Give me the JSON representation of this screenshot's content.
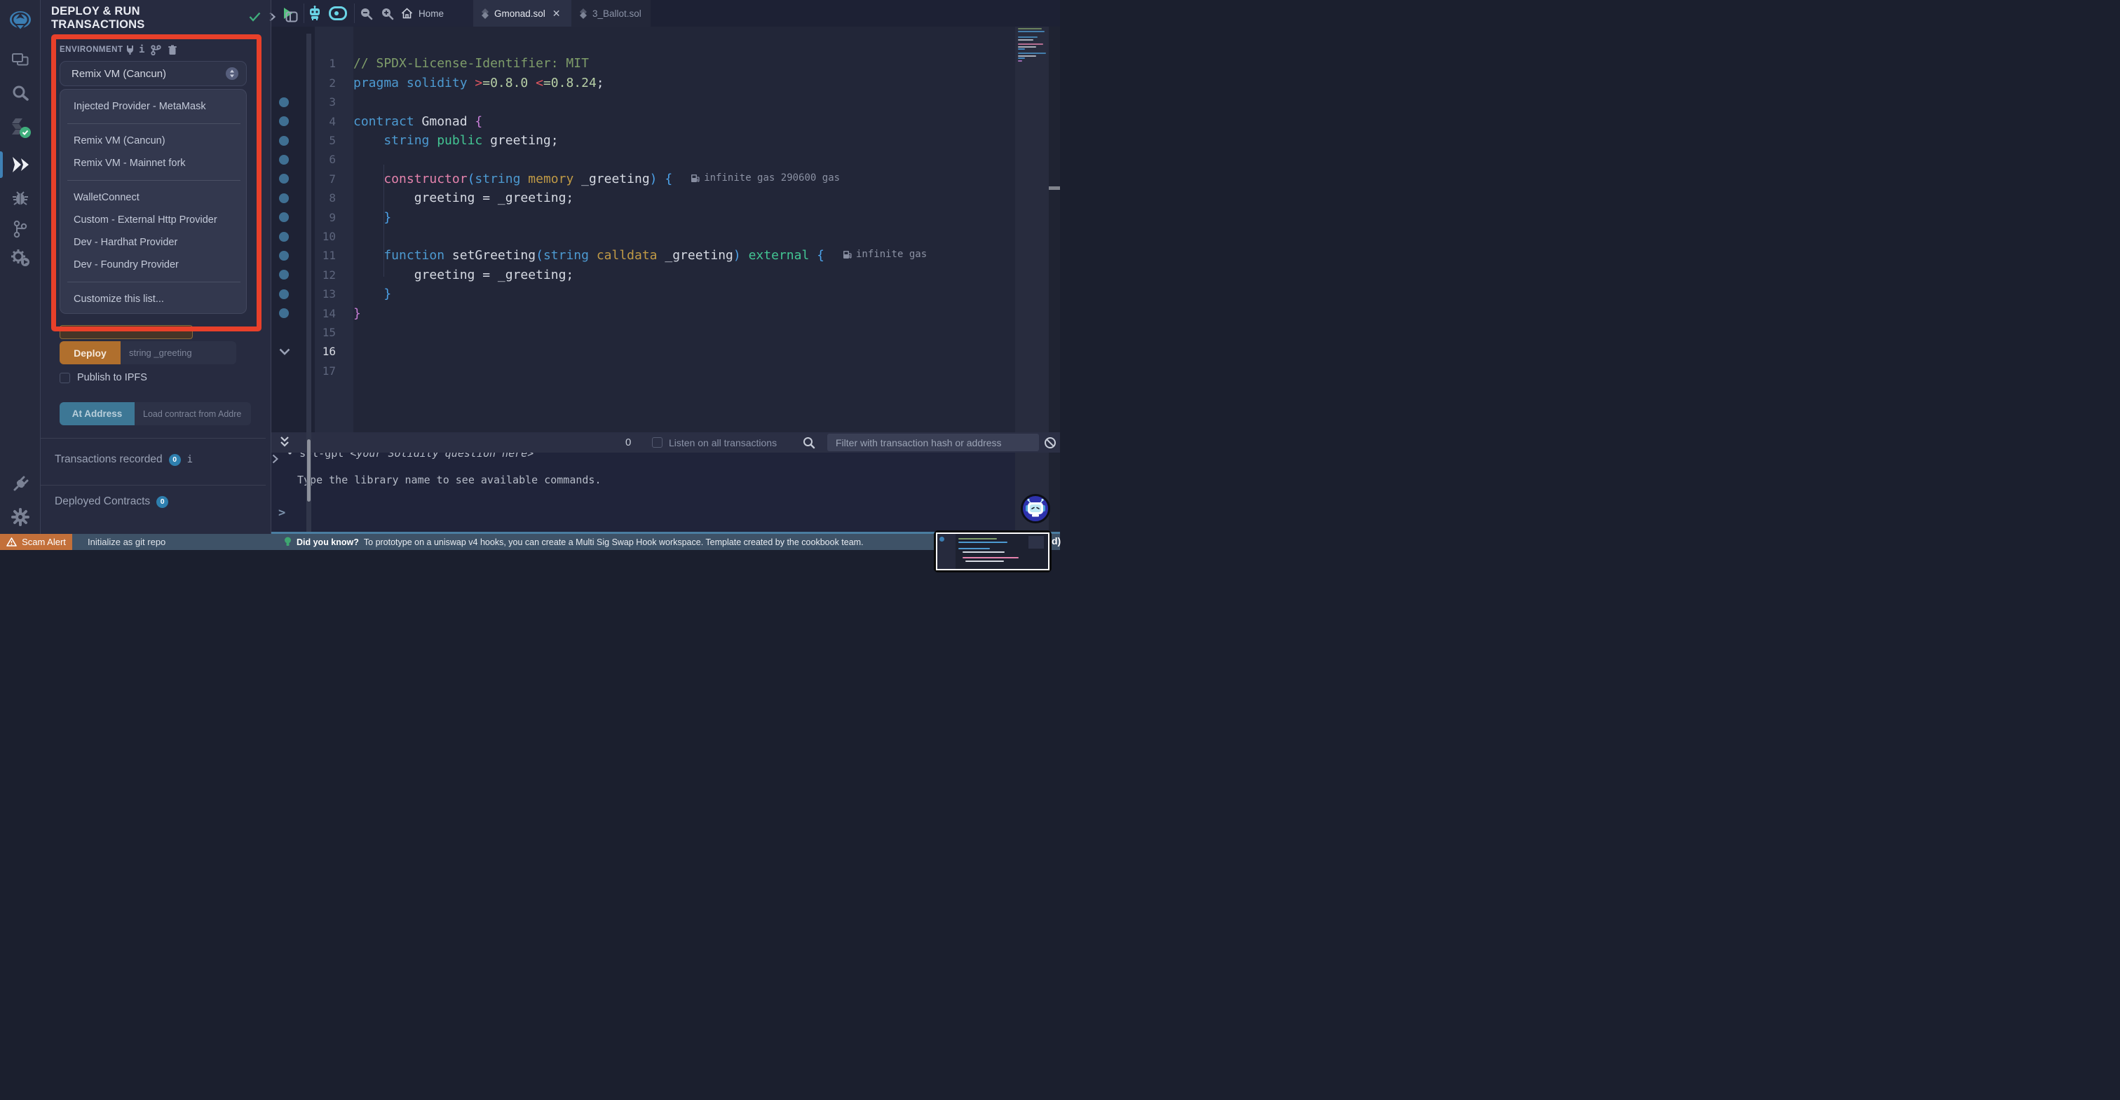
{
  "sidebar": {
    "icons": [
      {
        "name": "remix-logo"
      },
      {
        "name": "file-explorer"
      },
      {
        "name": "search"
      },
      {
        "name": "solidity-compiler"
      },
      {
        "name": "deploy-and-run"
      },
      {
        "name": "debugger"
      },
      {
        "name": "git"
      },
      {
        "name": "solidity-analyzers"
      },
      {
        "name": "plugin-manager"
      },
      {
        "name": "settings"
      }
    ]
  },
  "panel": {
    "title_line1": "DEPLOY & RUN",
    "title_line2": "TRANSACTIONS",
    "env": {
      "label": "ENVIRONMENT",
      "selected": "Remix VM (Cancun)",
      "menu": [
        [
          "Injected Provider - MetaMask"
        ],
        [
          "Remix VM (Cancun)",
          "Remix VM - Mainnet fork"
        ],
        [
          "WalletConnect",
          "Custom - External Http Provider",
          "Dev - Hardhat Provider",
          "Dev - Foundry Provider"
        ],
        [
          "Customize this list..."
        ]
      ]
    },
    "deploy": {
      "button": "Deploy",
      "placeholder": "string _greeting"
    },
    "publish_label": "Publish to IPFS",
    "at_address": {
      "button": "At Address",
      "placeholder": "Load contract from Addre"
    },
    "transactions": {
      "label": "Transactions recorded",
      "count": "0"
    },
    "deployed": {
      "label": "Deployed Contracts",
      "count": "0"
    },
    "info_glyph": "i"
  },
  "editor": {
    "home_label": "Home",
    "tabs": [
      {
        "label": "Gmonad.sol",
        "active": true
      },
      {
        "label": "3_Ballot.sol",
        "active": false
      }
    ],
    "active_line": 16,
    "total_lines": 17,
    "dotted_lines": [
      3,
      4,
      5,
      6,
      7,
      8,
      9,
      10,
      11,
      12,
      13,
      14
    ],
    "lines": [
      {
        "n": 1,
        "tokens": [
          [
            "// SPDX-License-Identifier: MIT",
            "com"
          ]
        ]
      },
      {
        "n": 2,
        "tokens": [
          [
            "pragma solidity ",
            "kw"
          ],
          [
            ">",
            "red"
          ],
          [
            "=0.8.0 ",
            "num"
          ],
          [
            "<",
            "red"
          ],
          [
            "=0.8.24",
            "num"
          ],
          [
            ";",
            "fg"
          ]
        ]
      },
      {
        "n": 3,
        "tokens": []
      },
      {
        "n": 4,
        "tokens": [
          [
            "contract ",
            "kw"
          ],
          [
            "Gmonad ",
            "fg"
          ],
          [
            "{",
            "mag"
          ]
        ]
      },
      {
        "n": 5,
        "tokens": [
          [
            "    string ",
            "kw"
          ],
          [
            "public ",
            "grn"
          ],
          [
            "greeting;",
            "fg"
          ]
        ]
      },
      {
        "n": 6,
        "tokens": []
      },
      {
        "n": 7,
        "tokens": [
          [
            "    constructor",
            "pnk"
          ],
          [
            "(",
            "blu"
          ],
          [
            "string ",
            "kw"
          ],
          [
            "memory ",
            "gld"
          ],
          [
            "_greeting",
            "fg"
          ],
          [
            ") {",
            "blu"
          ]
        ],
        "gas": "infinite gas 290600 gas"
      },
      {
        "n": 8,
        "tokens": [
          [
            "        greeting = _greeting;",
            "fg"
          ]
        ]
      },
      {
        "n": 9,
        "tokens": [
          [
            "    }",
            "blu"
          ]
        ]
      },
      {
        "n": 10,
        "tokens": []
      },
      {
        "n": 11,
        "tokens": [
          [
            "    function ",
            "kw"
          ],
          [
            "setGreeting",
            "fg"
          ],
          [
            "(",
            "blu"
          ],
          [
            "string ",
            "kw"
          ],
          [
            "calldata ",
            "gld"
          ],
          [
            "_greeting",
            "fg"
          ],
          [
            ") ",
            "blu"
          ],
          [
            "external ",
            "grn"
          ],
          [
            "{",
            "blu"
          ]
        ],
        "gas": "infinite gas"
      },
      {
        "n": 12,
        "tokens": [
          [
            "        greeting = _greeting;",
            "fg"
          ]
        ]
      },
      {
        "n": 13,
        "tokens": [
          [
            "    }",
            "blu"
          ]
        ]
      },
      {
        "n": 14,
        "tokens": [
          [
            "}",
            "mag"
          ]
        ]
      },
      {
        "n": 15,
        "tokens": []
      },
      {
        "n": 16,
        "tokens": []
      },
      {
        "n": 17,
        "tokens": []
      }
    ]
  },
  "terminal": {
    "count": "0",
    "listen_label": "Listen on all transactions",
    "filter_placeholder": "Filter with transaction hash or address",
    "line1_segments": [
      {
        "t": "sol-gpt ",
        "italic": false
      },
      {
        "t": "<your Solidity question here>",
        "italic": true
      }
    ],
    "line2": "Type the library name to see available commands.",
    "prompt": ">"
  },
  "statusbar": {
    "scam_alert": "Scam Alert",
    "git_init": "Initialize as git repo",
    "tip_title": "Did you know?",
    "tip_text": "To prototype on a uniswap v4 hooks, you can create a Multi Sig Swap Hook workspace. Template created by the cookbook team.",
    "right_fragment": "d)"
  },
  "colors": {
    "annotation_red": "#e8402a",
    "deploy_orange": "#b06f2d",
    "at_address_teal": "#3d7795",
    "badge_blue": "#2e7fae",
    "statusbar_slate": "#3e5267",
    "scam_orange": "#c3703a",
    "accent_cyan": "#6ad4e6",
    "run_green": "#52c17d"
  }
}
